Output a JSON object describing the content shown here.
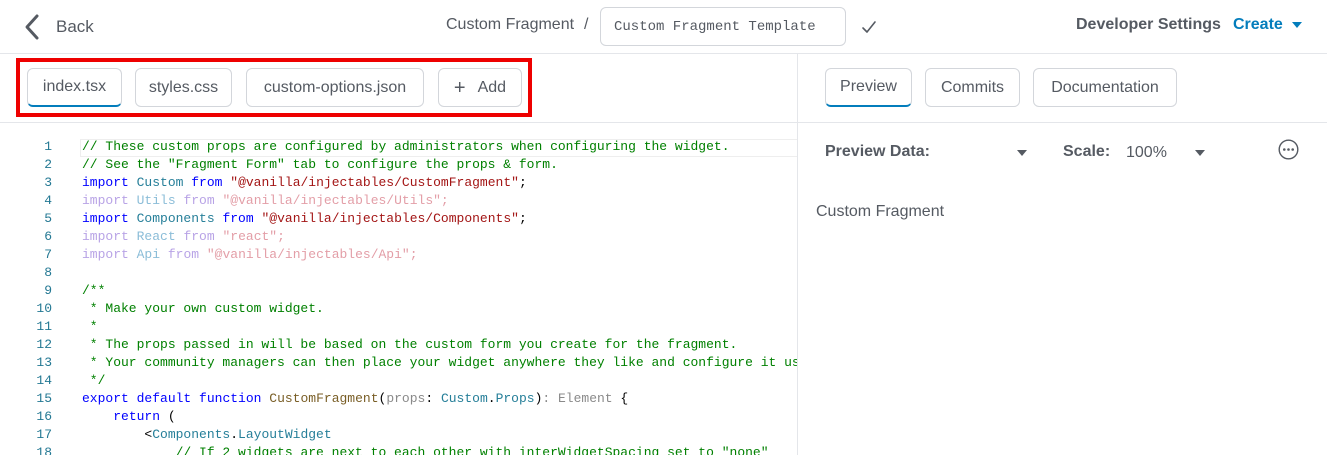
{
  "header": {
    "back_label": "Back",
    "breadcrumb": "Custom Fragment",
    "separator": "/",
    "template_name_value": "Custom Fragment Template",
    "developer_settings": "Developer Settings",
    "create_label": "Create"
  },
  "file_tabs": {
    "items": [
      {
        "label": "index.tsx",
        "active": true
      },
      {
        "label": "styles.css",
        "active": false
      },
      {
        "label": "custom-options.json",
        "active": false
      }
    ],
    "add_label": "Add",
    "highlight_color": "#ee0000"
  },
  "preview_panel": {
    "tabs": [
      {
        "label": "Preview",
        "active": true
      },
      {
        "label": "Commits",
        "active": false
      },
      {
        "label": "Documentation",
        "active": false
      }
    ],
    "preview_data_label": "Preview Data:",
    "scale_label": "Scale:",
    "scale_value": "100%",
    "content_text": "Custom Fragment"
  },
  "code": {
    "line_numbers": [
      "1",
      "2",
      "3",
      "4",
      "5",
      "6",
      "7",
      "8",
      "9",
      "10",
      "11",
      "12",
      "13",
      "14",
      "15",
      "16",
      "17",
      "18"
    ],
    "lines": [
      [
        [
          "c-comment",
          "// These custom props are configured by administrators when configuring the widget."
        ]
      ],
      [
        [
          "c-comment",
          "// See the \"Fragment Form\" tab to configure the props & form."
        ]
      ],
      [
        [
          "c-kw",
          "import"
        ],
        [
          "c-plain",
          " "
        ],
        [
          "c-type",
          "Custom"
        ],
        [
          "c-plain",
          " "
        ],
        [
          "c-kw",
          "from"
        ],
        [
          "c-plain",
          " "
        ],
        [
          "c-str",
          "\"@vanilla/injectables/CustomFragment\""
        ],
        [
          "c-plain",
          ";"
        ]
      ],
      [
        [
          "c-dim-kw",
          "import"
        ],
        [
          "c-plain",
          " "
        ],
        [
          "c-dim-id",
          "Utils"
        ],
        [
          "c-plain",
          " "
        ],
        [
          "c-dim-kw",
          "from"
        ],
        [
          "c-plain",
          " "
        ],
        [
          "c-dim-str",
          "\"@vanilla/injectables/Utils\""
        ],
        [
          "c-dim-str",
          ";"
        ]
      ],
      [
        [
          "c-kw",
          "import"
        ],
        [
          "c-plain",
          " "
        ],
        [
          "c-type",
          "Components"
        ],
        [
          "c-plain",
          " "
        ],
        [
          "c-kw",
          "from"
        ],
        [
          "c-plain",
          " "
        ],
        [
          "c-str",
          "\"@vanilla/injectables/Components\""
        ],
        [
          "c-plain",
          ";"
        ]
      ],
      [
        [
          "c-dim-kw",
          "import"
        ],
        [
          "c-plain",
          " "
        ],
        [
          "c-dim-id",
          "React"
        ],
        [
          "c-plain",
          " "
        ],
        [
          "c-dim-kw",
          "from"
        ],
        [
          "c-plain",
          " "
        ],
        [
          "c-dim-str",
          "\"react\""
        ],
        [
          "c-dim-str",
          ";"
        ]
      ],
      [
        [
          "c-dim-kw",
          "import"
        ],
        [
          "c-plain",
          " "
        ],
        [
          "c-dim-id",
          "Api"
        ],
        [
          "c-plain",
          " "
        ],
        [
          "c-dim-kw",
          "from"
        ],
        [
          "c-plain",
          " "
        ],
        [
          "c-dim-str",
          "\"@vanilla/injectables/Api\""
        ],
        [
          "c-dim-str",
          ";"
        ]
      ],
      [],
      [
        [
          "c-comment",
          "/**"
        ]
      ],
      [
        [
          "c-comment",
          " * Make your own custom widget."
        ]
      ],
      [
        [
          "c-comment",
          " *"
        ]
      ],
      [
        [
          "c-comment",
          " * The props passed in will be based on the custom form you create for the fragment."
        ]
      ],
      [
        [
          "c-comment",
          " * Your community managers can then place your widget anywhere they like and configure it using t"
        ]
      ],
      [
        [
          "c-comment",
          " */"
        ]
      ],
      [
        [
          "c-kw",
          "export"
        ],
        [
          "c-plain",
          " "
        ],
        [
          "c-kw",
          "default"
        ],
        [
          "c-plain",
          " "
        ],
        [
          "c-kw",
          "function"
        ],
        [
          "c-plain",
          " "
        ],
        [
          "c-fn",
          "CustomFragment"
        ],
        [
          "c-plain",
          "("
        ],
        [
          "c-grey",
          "props"
        ],
        [
          "c-plain",
          ": "
        ],
        [
          "c-type",
          "Custom"
        ],
        [
          "c-plain",
          "."
        ],
        [
          "c-type",
          "Props"
        ],
        [
          "c-plain",
          ")"
        ],
        [
          "c-grey",
          ": Element"
        ],
        [
          "c-plain",
          " {"
        ]
      ],
      [
        [
          "c-plain",
          "    "
        ],
        [
          "c-kw",
          "return"
        ],
        [
          "c-plain",
          " ("
        ]
      ],
      [
        [
          "c-plain",
          "        <"
        ],
        [
          "c-type",
          "Components"
        ],
        [
          "c-plain",
          "."
        ],
        [
          "c-type",
          "LayoutWidget"
        ]
      ],
      [
        [
          "c-plain",
          "            "
        ],
        [
          "c-comment",
          "// If 2 widgets are next to each other with interWidgetSpacing set to \"none\""
        ]
      ]
    ]
  }
}
